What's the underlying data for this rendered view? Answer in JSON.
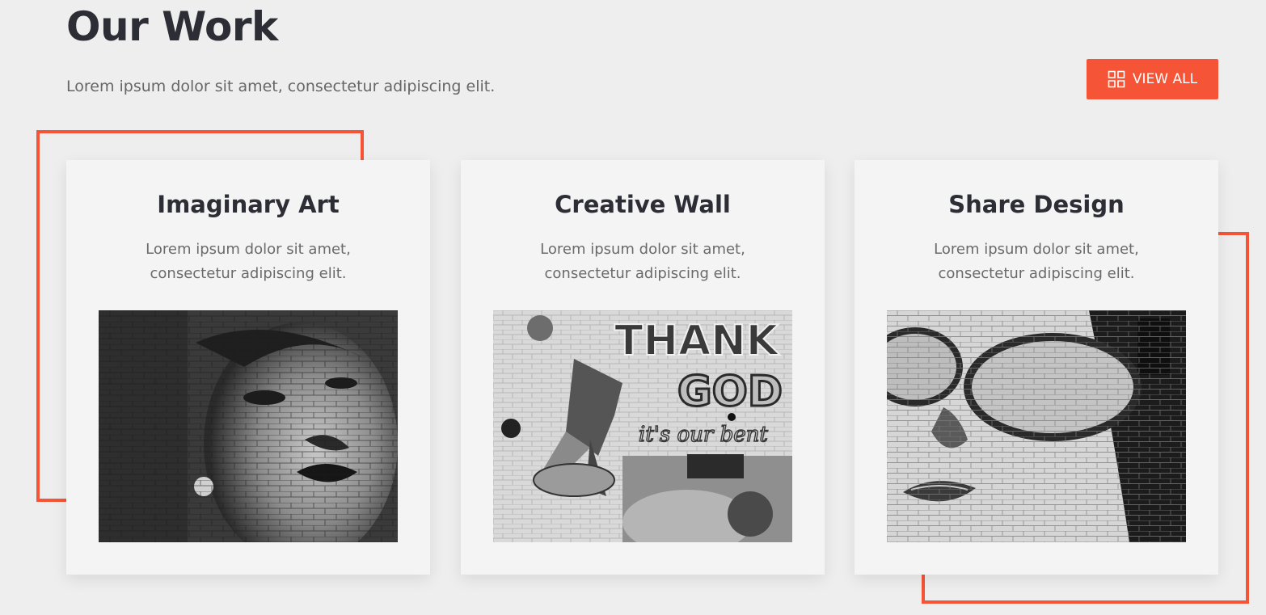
{
  "header": {
    "title": "Our Work",
    "subtitle": "Lorem ipsum dolor sit amet, consectetur adipiscing elit.",
    "view_all_label": "VIEW ALL",
    "view_all_icon": "grid-icon"
  },
  "colors": {
    "accent": "#f55436",
    "background": "#eeeeee",
    "card": "#f4f4f4",
    "title": "#2c2d35"
  },
  "cards": [
    {
      "title": "Imaginary Art",
      "desc_line1": "Lorem ipsum dolor sit amet,",
      "desc_line2": "consectetur adipiscing elit."
    },
    {
      "title": "Creative Wall",
      "desc_line1": "Lorem ipsum dolor sit amet,",
      "desc_line2": "consectetur adipiscing elit.",
      "mural_text_1": "THANK",
      "mural_text_2": "GOD",
      "mural_text_3": "it's our bent"
    },
    {
      "title": "Share Design",
      "desc_line1": "Lorem ipsum dolor sit amet,",
      "desc_line2": "consectetur adipiscing elit."
    }
  ]
}
